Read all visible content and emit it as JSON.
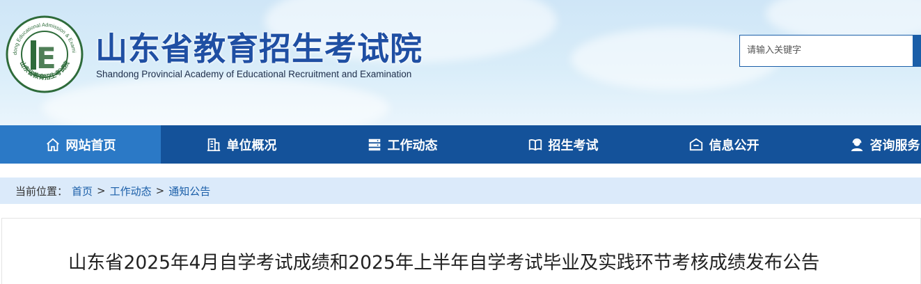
{
  "header": {
    "title": "山东省教育招生考试院",
    "subtitle": "Shandong Provincial Academy of Educational Recruitment and Examination",
    "logo_text_top": "Shandong Educational Admission & Examination",
    "logo_text_bottom": "山东省教育招生考试院",
    "logo_letter": "E"
  },
  "search": {
    "placeholder": "请输入关键字"
  },
  "nav": {
    "items": [
      {
        "label": "网站首页",
        "icon": "home-icon",
        "active": true
      },
      {
        "label": "单位概况",
        "icon": "building-icon",
        "active": false
      },
      {
        "label": "工作动态",
        "icon": "server-list-icon",
        "active": false
      },
      {
        "label": "招生考试",
        "icon": "book-icon",
        "active": false
      },
      {
        "label": "信息公开",
        "icon": "info-box-icon",
        "active": false
      },
      {
        "label": "咨询服务",
        "icon": "headset-user-icon",
        "active": false
      }
    ]
  },
  "breadcrumb": {
    "prefix": "当前位置：",
    "items": [
      "首页",
      "工作动态",
      "通知公告"
    ],
    "separator": ">"
  },
  "article": {
    "title": "山东省2025年4月自学考试成绩和2025年上半年自学考试毕业及实践环节考核成绩发布公告"
  },
  "colors": {
    "brand_blue": "#14529a",
    "nav_active": "#2b79c6",
    "breadcrumb_bg": "#dbeafa",
    "title_blue": "#1f4fa3"
  }
}
